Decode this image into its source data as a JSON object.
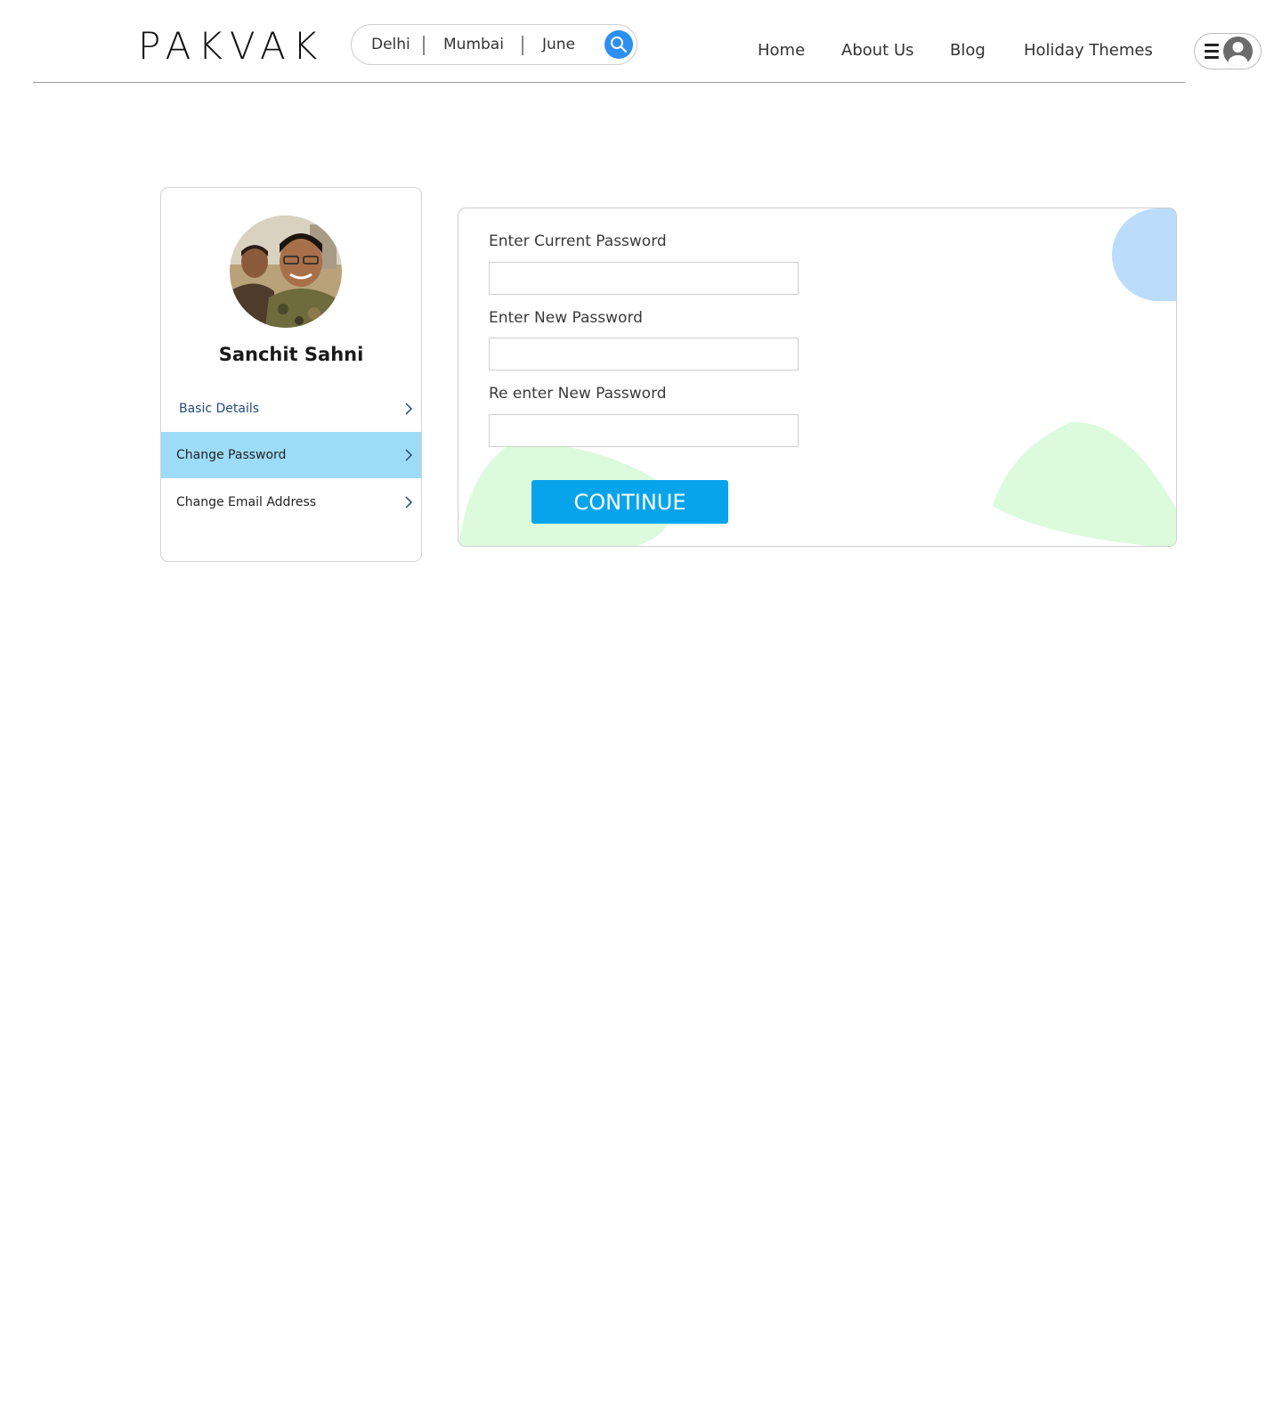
{
  "header": {
    "logo_text": "PAKVAK",
    "search": {
      "from": "Delhi",
      "to": "Mumbai",
      "month": "June"
    },
    "nav": {
      "home": "Home",
      "about": "About Us",
      "blog": "Blog",
      "themes": "Holiday Themes"
    }
  },
  "profile": {
    "name": "Sanchit Sahni",
    "menu": [
      {
        "label": "Basic Details"
      },
      {
        "label": "Change Password"
      },
      {
        "label": "Change Email Address"
      }
    ]
  },
  "form": {
    "current_password_label": "Enter Current Password",
    "new_password_label": "Enter New Password",
    "reenter_password_label": "Re enter New Password",
    "current_password_value": "",
    "new_password_value": "",
    "reenter_password_value": "",
    "continue_label": "CONTINUE"
  },
  "colors": {
    "accent": "#07a4ec",
    "search_button": "#2d8ff2",
    "active_menu": "#9ddcf8",
    "blob_blue": "#bcdcfb",
    "blob_green": "#dcfadc"
  }
}
